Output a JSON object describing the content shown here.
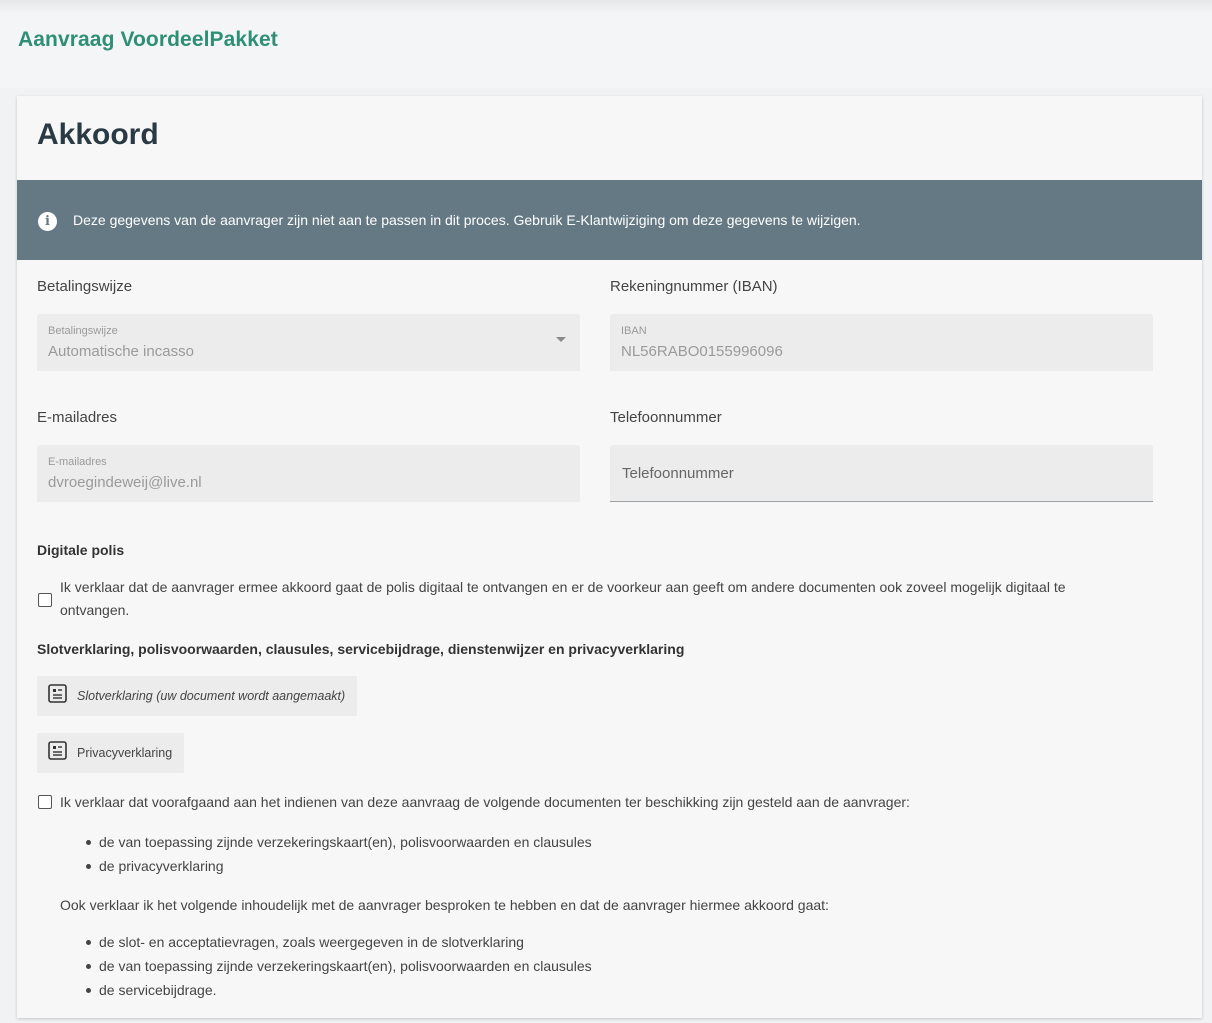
{
  "app": {
    "title": "Aanvraag VoordeelPakket"
  },
  "card": {
    "title": "Akkoord"
  },
  "info_banner": {
    "icon": "info-icon",
    "text": "Deze gegevens van de aanvrager zijn niet aan te passen in dit proces. Gebruik E-Klantwijziging om deze gegevens te wijzigen."
  },
  "fields": {
    "payment": {
      "label": "Betalingswijze",
      "small_label": "Betalingswijze",
      "value": "Automatische incasso"
    },
    "iban": {
      "label": "Rekeningnummer (IBAN)",
      "small_label": "IBAN",
      "value": "NL56RABO0155996096"
    },
    "email": {
      "label": "E-mailadres",
      "small_label": "E-mailadres",
      "value": "dvroegindeweij@live.nl"
    },
    "phone": {
      "label": "Telefoonnummer",
      "placeholder": "Telefoonnummer",
      "value": ""
    }
  },
  "digital_policy": {
    "heading": "Digitale polis",
    "checkbox_line1": "Ik verklaar dat de aanvrager ermee akkoord gaat de polis digitaal te ontvangen en er de voorkeur aan geeft om andere documenten ook zoveel mogelijk digitaal te",
    "checkbox_line2": "ontvangen.",
    "checked": false
  },
  "documents": {
    "heading": "Slotverklaring, polisvoorwaarden, clausules, servicebijdrage, dienstenwijzer en privacyverklaring",
    "items": [
      {
        "label": "Slotverklaring (uw document wordt aangemaakt)",
        "icon": "document-icon"
      },
      {
        "label": "Privacyverklaring",
        "icon": "document-icon"
      }
    ]
  },
  "declaration": {
    "checkbox_text": "Ik verklaar dat voorafgaand aan het indienen van deze aanvraag de volgende documenten ter beschikking zijn gesteld aan de aanvrager:",
    "checked": false,
    "list1": [
      "de van toepassing zijnde verzekeringskaart(en), polisvoorwaarden en clausules",
      "de privacyverklaring"
    ],
    "text2": "Ook verklaar ik het volgende inhoudelijk met de aanvrager besproken te hebben en dat de aanvrager hiermee akkoord gaat:",
    "list2": [
      "de slot- en acceptatievragen, zoals weergegeven in de slotverklaring",
      "de van toepassing zijnde verzekeringskaart(en), polisvoorwaarden en clausules",
      "de servicebijdrage."
    ]
  },
  "colors": {
    "brand": "#2f8f76",
    "banner": "#647983"
  }
}
